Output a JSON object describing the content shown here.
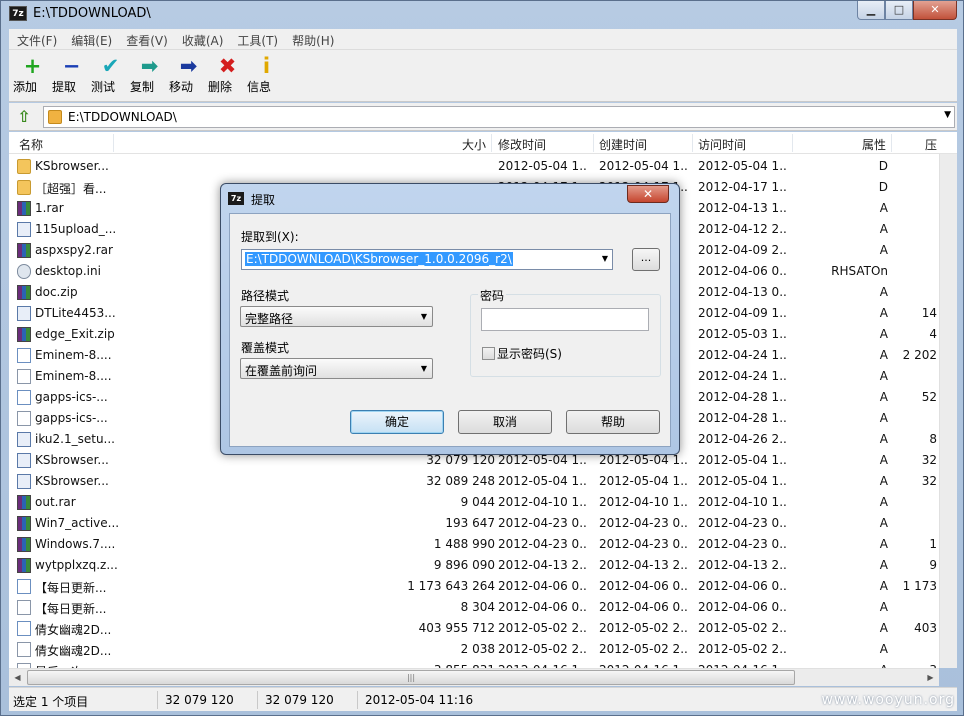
{
  "window": {
    "title": "E:\\TDDOWNLOAD\\",
    "app_icon": "7z",
    "controls": [
      "minimize",
      "maximize",
      "close"
    ]
  },
  "menu": [
    "文件(F)",
    "编辑(E)",
    "查看(V)",
    "收藏(A)",
    "工具(T)",
    "帮助(H)"
  ],
  "toolbar": [
    {
      "label": "添加",
      "icon": "+",
      "color": "#1fa51f"
    },
    {
      "label": "提取",
      "icon": "−",
      "color": "#1b3fb5"
    },
    {
      "label": "测试",
      "icon": "✔",
      "color": "#19a7b8"
    },
    {
      "label": "复制",
      "icon": "➡",
      "color": "#1e9a8c"
    },
    {
      "label": "移动",
      "icon": "➡",
      "color": "#1b3a9e"
    },
    {
      "label": "删除",
      "icon": "✖",
      "color": "#d41e1e"
    },
    {
      "label": "信息",
      "icon": "i",
      "color": "#e0a800"
    }
  ],
  "address": "E:\\TDDOWNLOAD\\",
  "columns": {
    "name": "名称",
    "size": "大小",
    "modified": "修改时间",
    "created": "创建时间",
    "accessed": "访问时间",
    "attributes": "属性",
    "compressed": "压"
  },
  "files": [
    {
      "icon": "folder",
      "name": "KSbrowser...",
      "size": "",
      "modified": "2012-05-04 1...",
      "created": "2012-05-04 1...",
      "accessed": "2012-05-04 1...",
      "attr": "D",
      "comp": ""
    },
    {
      "icon": "folder",
      "name": "［超强］看...",
      "size": "",
      "modified": "2012-04-17 1...",
      "created": "2012-04-17 1...",
      "accessed": "2012-04-17 1...",
      "attr": "D",
      "comp": ""
    },
    {
      "icon": "rar",
      "name": "1.rar",
      "size": "",
      "modified": "",
      "created": "",
      "accessed": "2012-04-13 1...",
      "attr": "A",
      "comp": ""
    },
    {
      "icon": "exe",
      "name": "115upload_...",
      "size": "",
      "modified": "",
      "created": "",
      "accessed": "2012-04-12 2...",
      "attr": "A",
      "comp": ""
    },
    {
      "icon": "rar",
      "name": "aspxspy2.rar",
      "size": "",
      "modified": "",
      "created": "",
      "accessed": "2012-04-09 2...",
      "attr": "A",
      "comp": ""
    },
    {
      "icon": "gear",
      "name": "desktop.ini",
      "size": "",
      "modified": "",
      "created": "",
      "accessed": "2012-04-06 0...",
      "attr": "RHSATOn",
      "comp": ""
    },
    {
      "icon": "rar",
      "name": "doc.zip",
      "size": "",
      "modified": "",
      "created": "",
      "accessed": "2012-04-13 0...",
      "attr": "A",
      "comp": ""
    },
    {
      "icon": "exe",
      "name": "DTLite4453...",
      "size": "",
      "modified": "",
      "created": "",
      "accessed": "2012-04-09 1...",
      "attr": "A",
      "comp": "14"
    },
    {
      "icon": "rar",
      "name": "edge_Exit.zip",
      "size": "",
      "modified": "",
      "created": "",
      "accessed": "2012-05-03 1...",
      "attr": "A",
      "comp": "4"
    },
    {
      "icon": "txt",
      "name": "Eminem-8....",
      "size": "",
      "modified": "",
      "created": "",
      "accessed": "2012-04-24 1...",
      "attr": "A",
      "comp": "2 202"
    },
    {
      "icon": "file",
      "name": "Eminem-8....",
      "size": "",
      "modified": "",
      "created": "",
      "accessed": "2012-04-24 1...",
      "attr": "A",
      "comp": ""
    },
    {
      "icon": "txt",
      "name": "gapps-ics-...",
      "size": "",
      "modified": "",
      "created": "",
      "accessed": "2012-04-28 1...",
      "attr": "A",
      "comp": "52"
    },
    {
      "icon": "file",
      "name": "gapps-ics-...",
      "size": "",
      "modified": "",
      "created": "",
      "accessed": "2012-04-28 1...",
      "attr": "A",
      "comp": ""
    },
    {
      "icon": "exe",
      "name": "iku2.1_setu...",
      "size": "",
      "modified": "",
      "created": "",
      "accessed": "2012-04-26 2...",
      "attr": "A",
      "comp": "8"
    },
    {
      "icon": "exe",
      "name": "KSbrowser...",
      "size": "32 079 120",
      "modified": "2012-05-04 1...",
      "created": "2012-05-04 1...",
      "accessed": "2012-05-04 1...",
      "attr": "A",
      "comp": "32"
    },
    {
      "icon": "exe",
      "name": "KSbrowser...",
      "size": "32 089 248",
      "modified": "2012-05-04 1...",
      "created": "2012-05-04 1...",
      "accessed": "2012-05-04 1...",
      "attr": "A",
      "comp": "32"
    },
    {
      "icon": "rar",
      "name": "out.rar",
      "size": "9 044",
      "modified": "2012-04-10 1...",
      "created": "2012-04-10 1...",
      "accessed": "2012-04-10 1...",
      "attr": "A",
      "comp": ""
    },
    {
      "icon": "rar",
      "name": "Win7_active...",
      "size": "193 647",
      "modified": "2012-04-23 0...",
      "created": "2012-04-23 0...",
      "accessed": "2012-04-23 0...",
      "attr": "A",
      "comp": ""
    },
    {
      "icon": "rar",
      "name": "Windows.7....",
      "size": "1 488 990",
      "modified": "2012-04-23 0...",
      "created": "2012-04-23 0...",
      "accessed": "2012-04-23 0...",
      "attr": "A",
      "comp": "1"
    },
    {
      "icon": "rar",
      "name": "wytpplxzq.z...",
      "size": "9 896 090",
      "modified": "2012-04-13 2...",
      "created": "2012-04-13 2...",
      "accessed": "2012-04-13 2...",
      "attr": "A",
      "comp": "9"
    },
    {
      "icon": "txt",
      "name": "【每日更新...",
      "size": "1 173 643 264",
      "modified": "2012-04-06 0...",
      "created": "2012-04-06 0...",
      "accessed": "2012-04-06 0...",
      "attr": "A",
      "comp": "1 173"
    },
    {
      "icon": "file",
      "name": "【每日更新...",
      "size": "8 304",
      "modified": "2012-04-06 0...",
      "created": "2012-04-06 0...",
      "accessed": "2012-04-06 0...",
      "attr": "A",
      "comp": ""
    },
    {
      "icon": "txt",
      "name": "倩女幽魂2D...",
      "size": "403 955 712",
      "modified": "2012-05-02 2...",
      "created": "2012-05-02 2...",
      "accessed": "2012-05-02 2...",
      "attr": "A",
      "comp": "403"
    },
    {
      "icon": "file",
      "name": "倩女幽魂2D...",
      "size": "2 038",
      "modified": "2012-05-02 2...",
      "created": "2012-05-02 2...",
      "accessed": "2012-05-02 2...",
      "attr": "A",
      "comp": ""
    },
    {
      "icon": "file",
      "name": "最后一次...",
      "size": "3 855 831",
      "modified": "2012-04-16 1...",
      "created": "2012-04-16 1...",
      "accessed": "2012-04-16 1...",
      "attr": "A",
      "comp": "3"
    }
  ],
  "status": {
    "selection": "选定 1 个项目",
    "size": "32 079 120",
    "packed": "32 079 120",
    "modified": "2012-05-04 11:16"
  },
  "watermark": "www.wooyun.org",
  "dialog": {
    "title": "提取",
    "icon": "7z",
    "close": "✕",
    "extract_to_label": "提取到(X):",
    "extract_to_value": "E:\\TDDOWNLOAD\\KSbrowser_1.0.0.2096_r2\\",
    "browse_label": "...",
    "path_mode_label": "路径模式",
    "path_mode_value": "完整路径",
    "overwrite_label": "覆盖模式",
    "overwrite_value": "在覆盖前询问",
    "password_label": "密码",
    "password_value": "",
    "show_password_label": "显示密码(S)",
    "ok": "确定",
    "cancel": "取消",
    "help": "帮助"
  }
}
